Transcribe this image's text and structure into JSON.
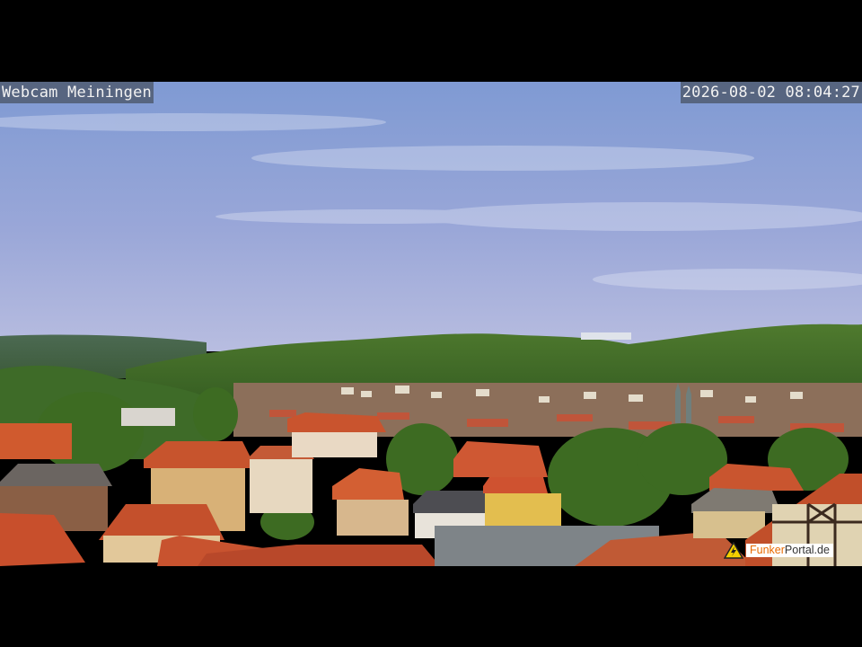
{
  "webcam": {
    "title": "Webcam Meiningen",
    "timestamp": "2026-08-02 08:04:27"
  },
  "logo": {
    "icon": "warning-triangle-icon",
    "accent": "Funker",
    "main": "Portal.de",
    "accent_color": "#e86a00"
  },
  "colors": {
    "sky_top": "#7f9ad3",
    "sky_bottom": "#b7bde0",
    "hills": "#3f6b2a",
    "roofs": "#c9542e"
  }
}
